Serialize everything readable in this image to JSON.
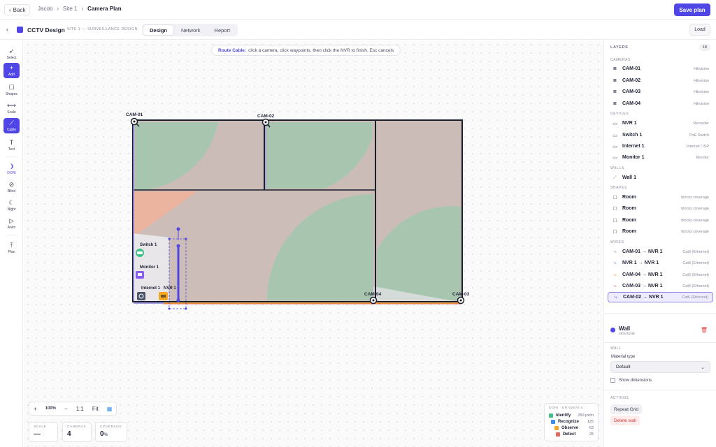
{
  "topbar": {
    "back_label": "Back",
    "breadcrumb": [
      "Jacob",
      "Site 1",
      "Camera Plan"
    ],
    "save_label": "Save plan"
  },
  "subbar": {
    "project_title": "CCTV Design",
    "project_subtitle": "SITE 1 — SURVEILLANCE DESIGN",
    "tabs": [
      "Design",
      "Network",
      "Report"
    ],
    "active_tab": "Design",
    "load_label": "Load"
  },
  "toolbar": {
    "tools": [
      {
        "label": "Select",
        "icon": "cursor-icon"
      },
      {
        "label": "Add",
        "icon": "plus-icon"
      },
      {
        "label": "Shapes",
        "icon": "square-icon"
      },
      {
        "label": "Scale",
        "icon": "ruler-icon"
      },
      {
        "label": "Cable",
        "icon": "cable-icon"
      },
      {
        "label": "Text",
        "icon": "text-icon"
      },
      {
        "label": "DORI",
        "icon": "dori-icon"
      },
      {
        "label": "Blind",
        "icon": "eye-off-icon"
      },
      {
        "label": "Night",
        "icon": "moon-icon"
      },
      {
        "label": "Anim",
        "icon": "play-icon"
      },
      {
        "label": "Plan",
        "icon": "upload-icon"
      }
    ],
    "active": [
      "Add",
      "Cable"
    ]
  },
  "canvas": {
    "hint_bold": "Route Cable:",
    "hint_text": "click a camera, click waypoints, then click the NVR to finish. Esc cancels",
    "labels": {
      "cam01": "CAM-01",
      "cam02": "CAM-02",
      "cam03": "CAM-03",
      "cam04": "CAM-04",
      "switch": "Switch 1",
      "monitor": "Monitor 1",
      "internet": "Internet 1",
      "nvr": "NVR 1"
    },
    "zoom": {
      "minus_left": "+",
      "value": "100%",
      "minus": "−",
      "one_to_one": "1:1",
      "fit": "Fit"
    },
    "stats": [
      {
        "label": "SCALE",
        "value": "—",
        "unit": ""
      },
      {
        "label": "CAMERAS",
        "value": "4",
        "unit": ""
      },
      {
        "label": "COVERAGE",
        "value": "0",
        "unit": "%"
      }
    ],
    "dori": {
      "title": "DORI · EN 62676-4",
      "rows": [
        {
          "name": "Identify",
          "value": "250 px/m",
          "color": "#3fbf8a"
        },
        {
          "name": "Recognize",
          "value": "125",
          "color": "#3b8ee8"
        },
        {
          "name": "Observe",
          "value": "63",
          "color": "#f5a623"
        },
        {
          "name": "Detect",
          "value": "25",
          "color": "#e8665a"
        }
      ]
    }
  },
  "layers": {
    "title": "LAYERS",
    "count": "18",
    "cameras_heading": "CAMERAS",
    "cameras": [
      {
        "name": "CAM-01",
        "meta": "Hikvision"
      },
      {
        "name": "CAM-02",
        "meta": "Hikvision"
      },
      {
        "name": "CAM-03",
        "meta": "Hikvision"
      },
      {
        "name": "CAM-04",
        "meta": "Hikvision"
      }
    ],
    "devices_heading": "DEVICES",
    "devices": [
      {
        "name": "NVR 1",
        "meta": "Recorder"
      },
      {
        "name": "Switch 1",
        "meta": "PoE Switch"
      },
      {
        "name": "Internet 1",
        "meta": "Internet / ISP"
      },
      {
        "name": "Monitor 1",
        "meta": "Monitor"
      }
    ],
    "walls_heading": "WALLS",
    "walls": [
      {
        "name": "Wall 1",
        "meta": ""
      }
    ],
    "shapes_heading": "SHAPES",
    "shapes": [
      {
        "name": "Room",
        "meta": "blocks coverage"
      },
      {
        "name": "Room",
        "meta": "blocks coverage"
      },
      {
        "name": "Room",
        "meta": "blocks coverage"
      },
      {
        "name": "Room",
        "meta": "blocks coverage"
      }
    ],
    "wires_heading": "WIRES",
    "wires": [
      {
        "name": "CAM-01 → NVR 1",
        "meta": "Cat6 (Ethernet)",
        "color": "#8b85e8"
      },
      {
        "name": "NVR 1 → NVR 1",
        "meta": "Cat6 (Ethernet)",
        "color": "#3b8ee8"
      },
      {
        "name": "CAM-04 → NVR 1",
        "meta": "Cat6 (Ethernet)",
        "color": "#f5a623"
      },
      {
        "name": "CAM-03 → NVR 1",
        "meta": "Cat6 (Ethernet)",
        "color": "#e8665a"
      },
      {
        "name": "CAM-02 → NVR 1",
        "meta": "Cat6 (Ethernet)",
        "color": "#4f46e5"
      }
    ],
    "selected_wire": "CAM-02 → NVR 1"
  },
  "properties": {
    "title": "Wall",
    "subtitle": "structural",
    "section": "WALL",
    "material_label": "Material type",
    "material_value": "Default",
    "show_dimensions": "Show dimensions",
    "actions_heading": "ACTIONS",
    "repeat_grid": "Repeat Grid",
    "delete_wall": "Delete wall"
  },
  "colors": {
    "accent": "#4f46e5",
    "danger": "#e03e3e"
  }
}
